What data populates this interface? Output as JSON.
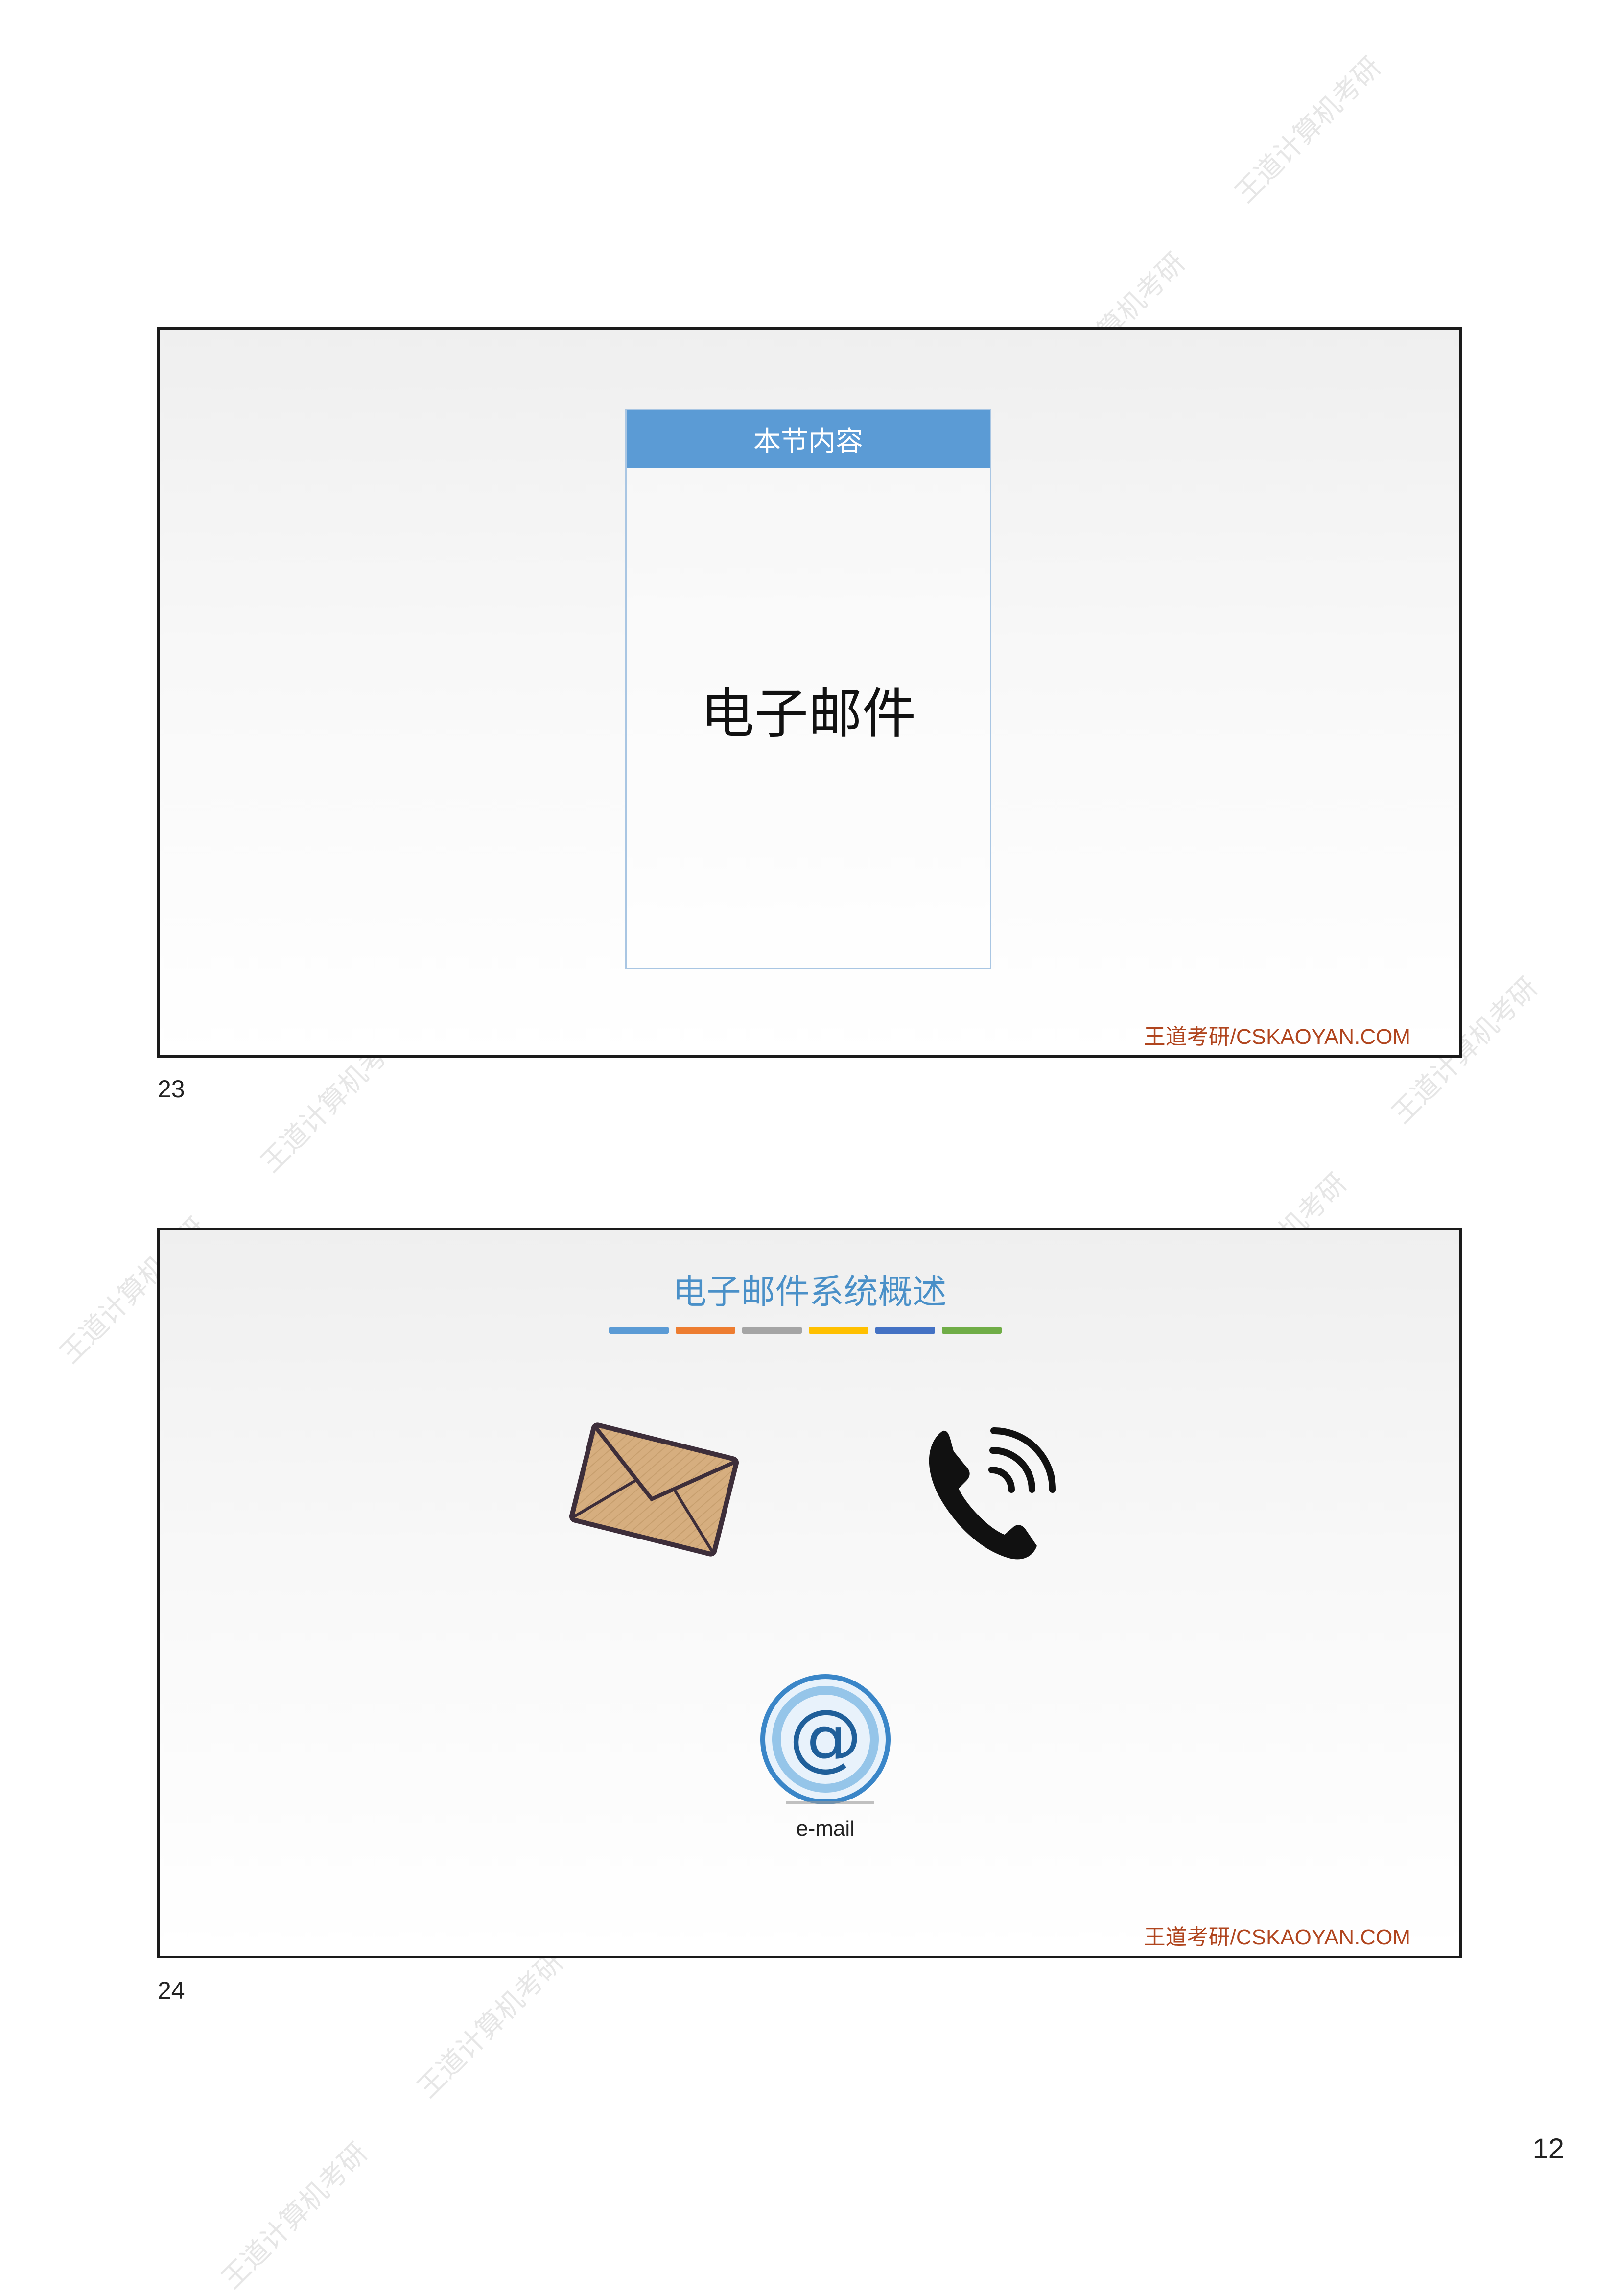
{
  "watermark_text": "王道计算机考研",
  "slides": [
    {
      "number": "23",
      "toc_header": "本节内容",
      "toc_item": "电子邮件",
      "footer": "王道考研/CSKAOYAN.COM"
    },
    {
      "number": "24",
      "title": "电子邮件系统概述",
      "color_bar": [
        "#5b9bd5",
        "#ed7d31",
        "#a5a5a5",
        "#ffc000",
        "#4472c4",
        "#70ad47"
      ],
      "icons": [
        "envelope-icon",
        "phone-icon",
        "at-sign-icon"
      ],
      "email_label": "e-mail",
      "footer": "王道考研/CSKAOYAN.COM"
    }
  ],
  "page_number": "12"
}
